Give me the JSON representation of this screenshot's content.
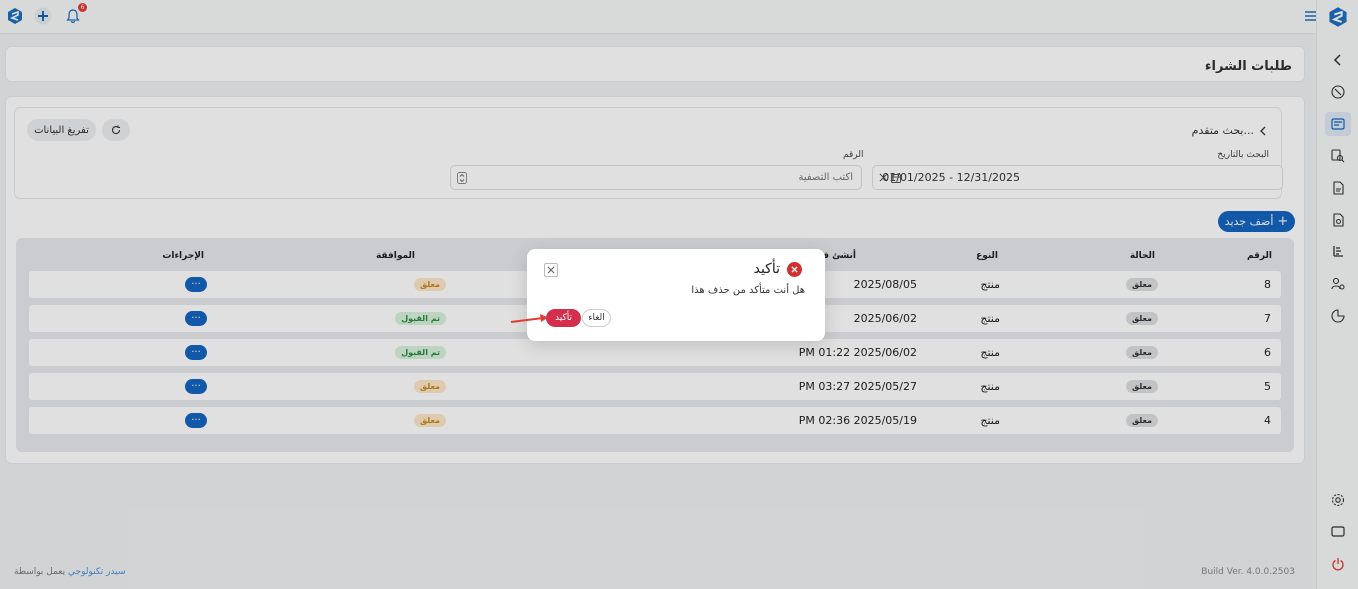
{
  "app": {
    "notifications_count": "6",
    "build_label": "Build Ver. 4.0.0.2503",
    "footer_prefix": "يعمل بواسطة",
    "footer_link": "سيدر تكنولوجي"
  },
  "page": {
    "title": "طلبات الشراء"
  },
  "search": {
    "advanced_label": "بحث متقدم...",
    "clear_label": "تفريغ البيانات",
    "date_label": "البحث بالتاريخ",
    "date_value": "01/01/2025 - 12/31/2025",
    "number_label": "الرقم",
    "number_placeholder": "أكتب التصفية"
  },
  "actions": {
    "add_new": "أضف جديد"
  },
  "table": {
    "headers": {
      "number": "الرقم",
      "status": "الحالة",
      "type": "النوع",
      "created": "أنشئ في",
      "approval": "الموافقة",
      "actions": "الإجراءات"
    },
    "rows": [
      {
        "number": "8",
        "status": "معلق",
        "type": "منتج",
        "created": "2025/08/05",
        "approval": "معلق",
        "approval_kind": "pending"
      },
      {
        "number": "7",
        "status": "معلق",
        "type": "منتج",
        "created": "2025/06/02",
        "approval": "تم القبول",
        "approval_kind": "accepted"
      },
      {
        "number": "6",
        "status": "معلق",
        "type": "منتج",
        "created": "PM 01:22 2025/06/02",
        "approval": "تم القبول",
        "approval_kind": "accepted"
      },
      {
        "number": "5",
        "status": "معلق",
        "type": "منتج",
        "created": "PM 03:27 2025/05/27",
        "approval": "معلق",
        "approval_kind": "pending"
      },
      {
        "number": "4",
        "status": "معلق",
        "type": "منتج",
        "created": "PM 02:36 2025/05/19",
        "approval": "معلق",
        "approval_kind": "pending"
      }
    ],
    "actions_glyph": "···"
  },
  "modal": {
    "title": "تأكيد",
    "message": "هل أنت متأكد من حذف هذا",
    "confirm_label": "تأكيد",
    "cancel_label": "الغاء"
  },
  "colors": {
    "primary": "#1565c0",
    "danger": "#d32f4c",
    "pending_bg": "#fde8c8",
    "accepted_bg": "#d7f2dc"
  }
}
